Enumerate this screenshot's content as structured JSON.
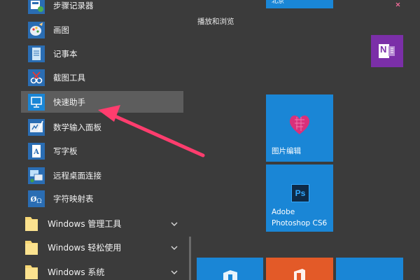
{
  "app_list": {
    "items": [
      {
        "label": "步骤记录器",
        "icon": "steps-recorder-icon"
      },
      {
        "label": "画图",
        "icon": "paint-icon"
      },
      {
        "label": "记事本",
        "icon": "notepad-icon"
      },
      {
        "label": "截图工具",
        "icon": "snipping-tool-icon"
      },
      {
        "label": "快速助手",
        "icon": "quick-assist-icon"
      },
      {
        "label": "数学输入面板",
        "icon": "math-input-icon"
      },
      {
        "label": "写字板",
        "icon": "wordpad-icon"
      },
      {
        "label": "远程桌面连接",
        "icon": "remote-desktop-icon"
      },
      {
        "label": "字符映射表",
        "icon": "character-map-icon"
      }
    ],
    "folders": [
      {
        "label": "Windows 管理工具"
      },
      {
        "label": "Windows 轻松使用"
      },
      {
        "label": "Windows 系统"
      }
    ]
  },
  "tiles": {
    "top_partial_label": "北京",
    "group_label": "播放和浏览",
    "photo_edit_label": "图片编辑",
    "photoshop_label_line1": "Adobe",
    "photoshop_label_line2": "Photoshop CS6",
    "photoshop_icon_text": "Ps",
    "onenote_icon_text": "N"
  },
  "colors": {
    "background": "#3b3b3b",
    "tile_blue": "#1a86d6",
    "highlight": "#5d5d5d",
    "arrow": "#ff3d6e",
    "onenote_purple": "#7b2fa8",
    "tile_orange": "#e35a28",
    "photoshop_dark": "#0e2a47"
  }
}
